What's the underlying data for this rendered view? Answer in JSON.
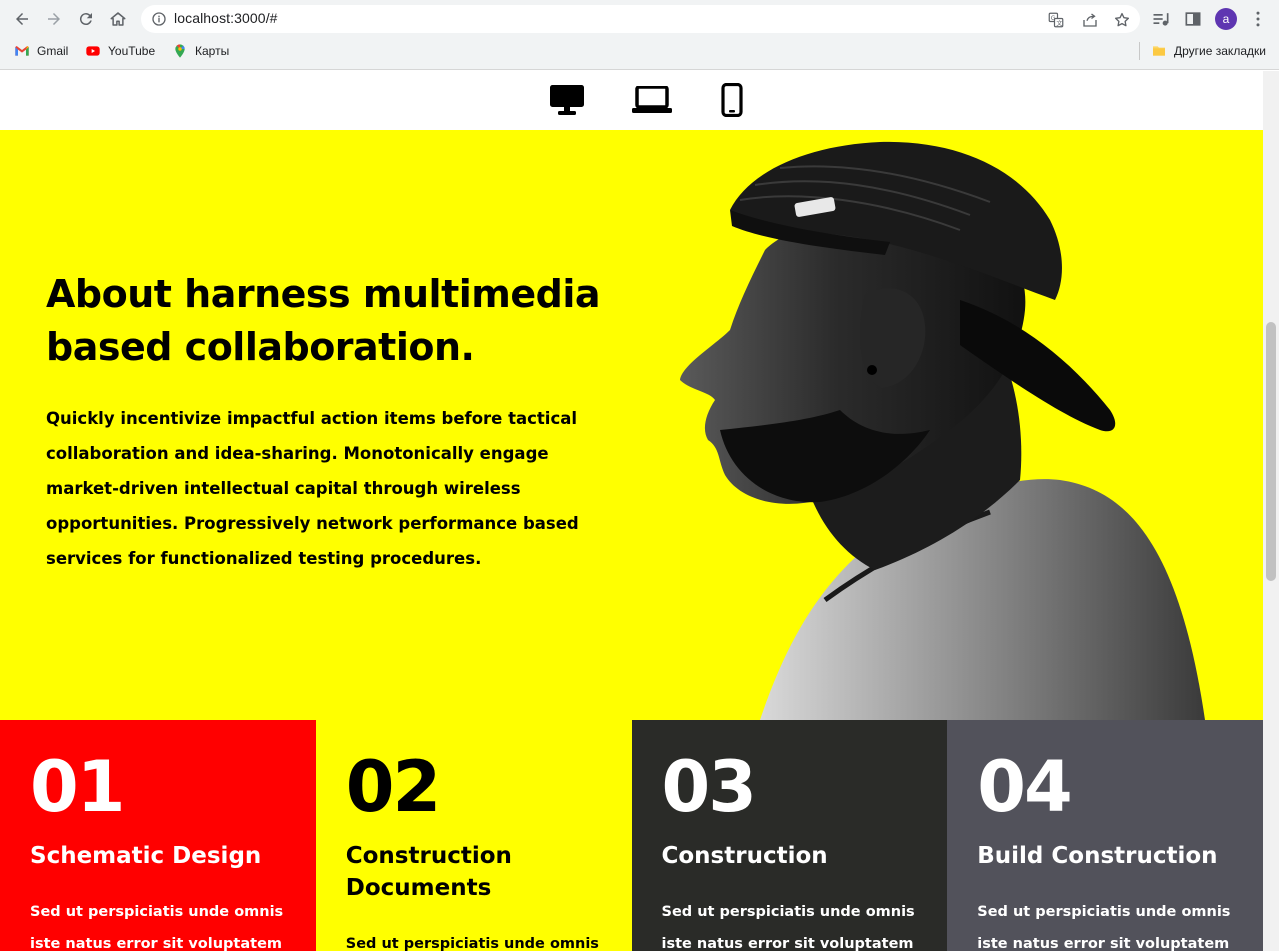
{
  "browser": {
    "url": "localhost:3000/#",
    "avatar_letter": "a",
    "bookmarks": [
      {
        "label": "Gmail",
        "icon": "gmail-icon"
      },
      {
        "label": "YouTube",
        "icon": "youtube-icon"
      },
      {
        "label": "Карты",
        "icon": "maps-icon"
      }
    ],
    "other_bookmarks": "Другие закладки"
  },
  "device_switcher": [
    {
      "name": "desktop",
      "icon": "desktop-icon"
    },
    {
      "name": "laptop",
      "icon": "laptop-icon"
    },
    {
      "name": "mobile",
      "icon": "mobile-icon"
    }
  ],
  "hero": {
    "title": "About harness multimedia based collaboration.",
    "text": "Quickly incentivize impactful action items before tactical collaboration and idea-sharing. Monotonically engage market-driven intellectual capital through wireless opportunities. Progressively network performance based services for functionalized testing procedures.",
    "background": "#ffff00"
  },
  "features": [
    {
      "number": "01",
      "title": "Schematic Design",
      "text": "Sed ut perspiciatis unde omnis iste natus error sit voluptatem",
      "background": "#ff0000",
      "color": "#ffffff"
    },
    {
      "number": "02",
      "title": "Construction Documents",
      "text": "Sed ut perspiciatis unde omnis iste natus error sit voluptatem",
      "background": "#ffff00",
      "color": "#000000"
    },
    {
      "number": "03",
      "title": "Construction",
      "text": "Sed ut perspiciatis unde omnis iste natus error sit voluptatem",
      "background": "#2a2b28",
      "color": "#ffffff"
    },
    {
      "number": "04",
      "title": "Build Construction",
      "text": "Sed ut perspiciatis unde omnis iste natus error sit voluptatem",
      "background": "#52525b",
      "color": "#ffffff"
    }
  ]
}
